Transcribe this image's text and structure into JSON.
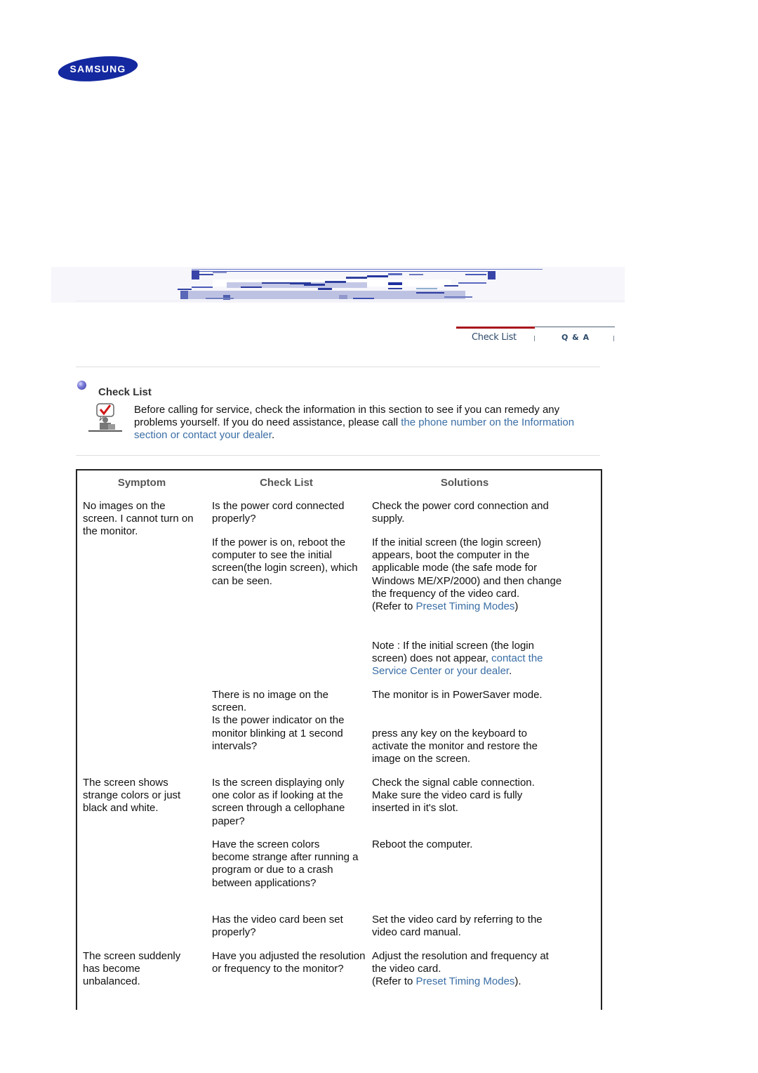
{
  "brand": {
    "logo_text": "SAMSUNG",
    "logo_color": "#1428a0"
  },
  "tabs": [
    {
      "label": "Check List",
      "active": true
    },
    {
      "label": "Q & A",
      "active": false
    }
  ],
  "section": {
    "title": "Check List",
    "intro_prefix": "Before calling for service, check the information in this section to see if you can remedy any problems yourself. If you do need assistance, please call ",
    "intro_link": "the phone number on the Information section or contact your dealer",
    "intro_suffix": "."
  },
  "table": {
    "headers": [
      "Symptom",
      "Check List",
      "Solutions"
    ],
    "rows": [
      {
        "symptom": "No images on the screen. I cannot turn on the monitor.",
        "check": "Is the power cord connected properly?",
        "solution": "Check the power cord connection and supply."
      },
      {
        "symptom": "",
        "check": "If the power is on, reboot the computer to see the initial screen(the login screen), which can be seen.",
        "solution": "If the initial screen (the login screen) appears, boot the computer in the applicable mode (the safe mode for Windows ME/XP/2000) and then change the frequency of the video card.",
        "solution_ref_prefix": "(Refer to ",
        "solution_ref_link": "Preset Timing Modes",
        "solution_ref_suffix": ")",
        "note_prefix": "Note : If the initial screen (the login screen) does not appear, ",
        "note_link": "contact the Service Center or your dealer",
        "note_suffix": "."
      },
      {
        "symptom": "",
        "check_a": "There is no image on the screen.",
        "check_b": "Is the power indicator on the monitor blinking at 1 second intervals?",
        "solution_a": "The monitor is in PowerSaver mode.",
        "solution_b": "press any key on the keyboard to activate the monitor and restore the image on the screen."
      },
      {
        "symptom": "The screen shows strange colors or just black and white.",
        "check": "Is the screen displaying only one color as if looking at the screen through a cellophane paper?",
        "solution": "Check the signal cable connection. Make sure the video card is fully inserted in it's slot."
      },
      {
        "symptom": "",
        "check": "Have the screen colors become strange after running a program or due to a crash between applications?",
        "solution": "Reboot the computer."
      },
      {
        "symptom": "",
        "check": "Has the video card been set properly?",
        "solution": "Set the video card by referring to the video card manual."
      },
      {
        "symptom": "The screen suddenly has become unbalanced.",
        "check": "Have you adjusted the resolution or frequency to the monitor?",
        "solution": "Adjust the resolution and frequency at the video card.",
        "solution_ref_prefix": "(Refer to ",
        "solution_ref_link": "Preset Timing Modes",
        "solution_ref_suffix": ")."
      }
    ]
  },
  "colors": {
    "link": "#3a6ea5",
    "tab_active": "#a8141e",
    "header_text": "#555555"
  }
}
